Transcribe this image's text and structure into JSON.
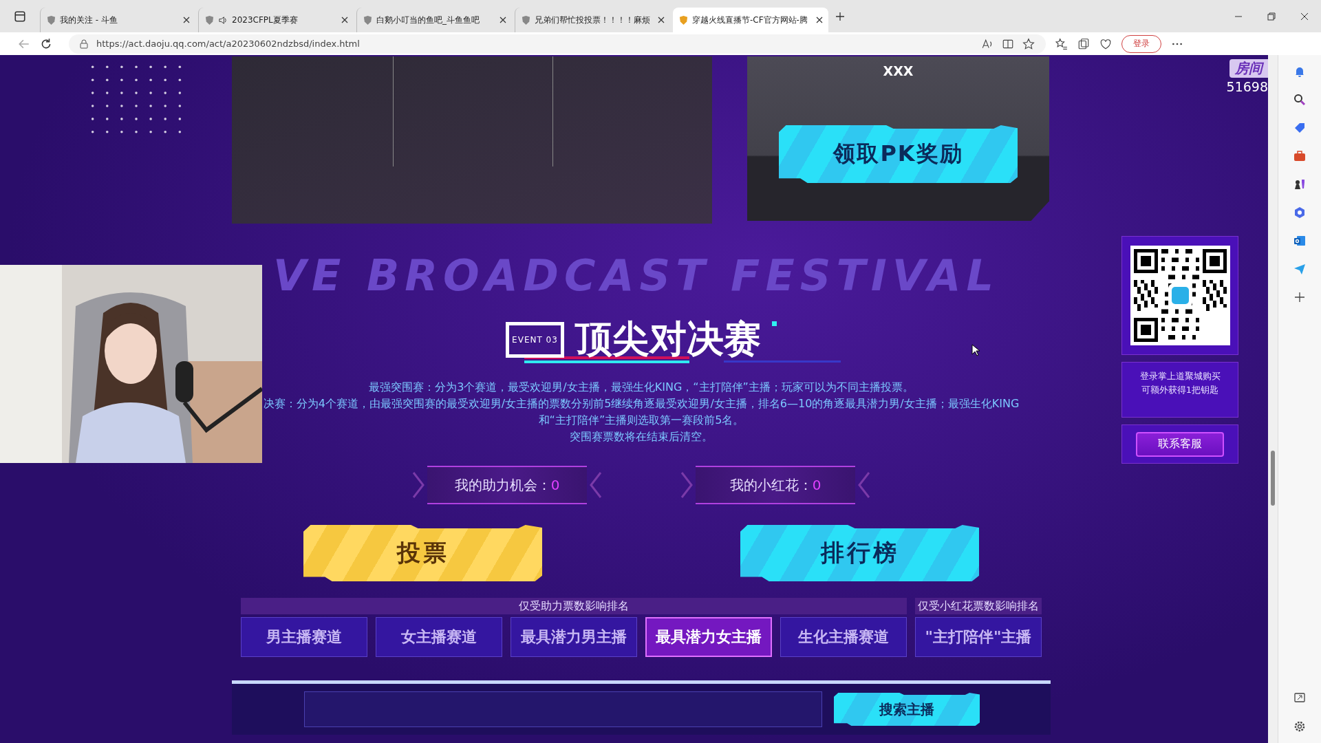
{
  "browser": {
    "tabs": [
      {
        "title": "我的关注 - 斗鱼",
        "audio": false,
        "selected": false
      },
      {
        "title": "2023CFPL夏季赛",
        "audio": true,
        "selected": false
      },
      {
        "title": "白鹅小叮当的鱼吧_斗鱼鱼吧",
        "audio": false,
        "selected": false
      },
      {
        "title": "兄弟们帮忙投投票！！！！麻烦",
        "audio": false,
        "selected": false
      },
      {
        "title": "穿越火线直播节-CF官方网站-腾",
        "audio": false,
        "selected": true
      }
    ],
    "url": "https://act.daoju.qq.com/act/a20230602ndzbsd/index.html",
    "profile_button": "登录"
  },
  "page": {
    "reward_card": {
      "name": "XXX",
      "button": "领取PK奖励"
    },
    "room": {
      "label": "房间",
      "number": "51698"
    },
    "qr_card": {
      "note_lines": [
        "登录掌上道聚城购买",
        "可额外获得1把钥匙"
      ],
      "contact_button": "联系客服"
    },
    "section": {
      "background_heading": "VE BROADCAST FESTIVAL",
      "badge": "EVENT 03",
      "title": "顶尖对决赛",
      "rules": [
        "最强突围赛：分为3个赛道，最受欢迎男/女主播，最强生化KING，“主打陪伴”主播；玩家可以为不同主播投票。",
        "决赛：分为4个赛道，由最强突围赛的最受欢迎男/女主播的票数分别前5继续角逐最受欢迎男/女主播，排名6—10的角逐最具潜力男/女主播；最强生化KING和“主打陪伴”主播则选取第一赛段前5名。",
        "突围赛票数将在结束后清空。"
      ]
    },
    "counters": [
      {
        "label": "我的助力机会：",
        "value": "0"
      },
      {
        "label": "我的小红花：",
        "value": "0"
      }
    ],
    "actions": [
      {
        "label": "投票",
        "kind": "vote"
      },
      {
        "label": "排行榜",
        "kind": "rank"
      }
    ],
    "lane_groups": [
      {
        "label": "仅受助力票数影响排名",
        "lanes": [
          {
            "label": "男主播赛道",
            "selected": false
          },
          {
            "label": "女主播赛道",
            "selected": false
          },
          {
            "label": "最具潜力男主播",
            "selected": false
          },
          {
            "label": "最具潜力女主播",
            "selected": true
          },
          {
            "label": "生化主播赛道",
            "selected": false
          }
        ]
      },
      {
        "label": "仅受小红花票数影响排名",
        "lanes": [
          {
            "label": "\"主打陪伴\"主播",
            "selected": false
          }
        ]
      }
    ],
    "search": {
      "button": "搜索主播"
    }
  }
}
